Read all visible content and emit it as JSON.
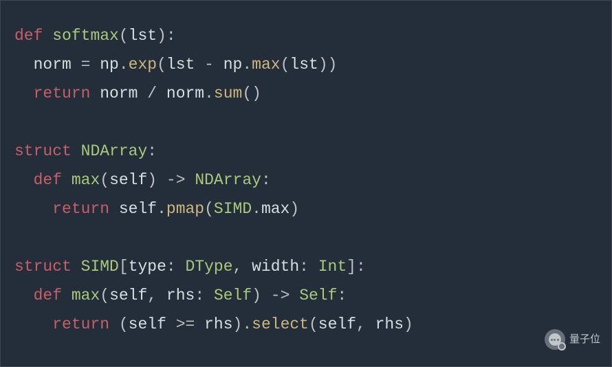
{
  "code": {
    "l1": {
      "kw_def": "def",
      "fn": "softmax",
      "open": "(",
      "arg": "lst",
      "close": "):"
    },
    "l2": {
      "indent": "  ",
      "lhs": "norm",
      "eq": " = ",
      "np": "np",
      "dot": ".",
      "exp": "exp",
      "open": "(",
      "arg1": "lst",
      "minus": " - ",
      "np2": "np",
      "dot2": ".",
      "max": "max",
      "open2": "(",
      "arg2": "lst",
      "close2": ")",
      "close": ")"
    },
    "l3": {
      "indent": "  ",
      "ret": "return",
      "sp": " ",
      "a": "norm",
      "div": " / ",
      "b": "norm",
      "dot": ".",
      "sum": "sum",
      "par": "()"
    },
    "l5": {
      "kw": "struct",
      "sp": " ",
      "name": "NDArray",
      "colon": ":"
    },
    "l6": {
      "indent": "  ",
      "kw_def": "def",
      "sp": " ",
      "fn": "max",
      "open": "(",
      "arg": "self",
      "close": ")",
      "arrow": " -> ",
      "rtype": "NDArray",
      "colon": ":"
    },
    "l7": {
      "indent": "    ",
      "ret": "return",
      "sp": " ",
      "self": "self",
      "dot": ".",
      "pmap": "pmap",
      "open": "(",
      "simd": "SIMD",
      "dot2": ".",
      "max": "max",
      "close": ")"
    },
    "l9": {
      "kw": "struct",
      "sp": " ",
      "name": "SIMD",
      "ob": "[",
      "p1": "type",
      "c1": ": ",
      "t1": "DType",
      "comma": ", ",
      "p2": "width",
      "c2": ": ",
      "t2": "Int",
      "cb": "]:"
    },
    "l10": {
      "indent": "  ",
      "kw_def": "def",
      "sp": " ",
      "fn": "max",
      "open": "(",
      "a1": "self",
      "comma": ", ",
      "a2": "rhs",
      "colon": ": ",
      "t": "Self",
      "close": ")",
      "arrow": " -> ",
      "rtype": "Self",
      "end": ":"
    },
    "l11": {
      "indent": "    ",
      "ret": "return",
      "sp": " ",
      "open": "(",
      "a": "self",
      "op": " >= ",
      "b": "rhs",
      "close": ")",
      "dot": ".",
      "sel": "select",
      "open2": "(",
      "c": "self",
      "comma": ", ",
      "d": "rhs",
      "close2": ")"
    }
  },
  "watermark": {
    "label": "量子位"
  }
}
